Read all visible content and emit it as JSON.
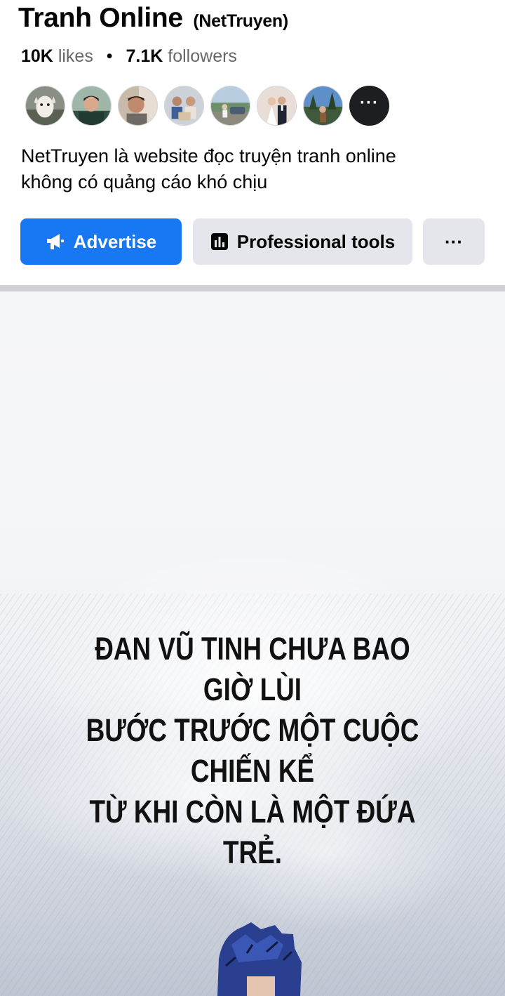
{
  "page": {
    "title": "Tranh Online",
    "handle": "(NetTruyen)",
    "likes_count": "10K",
    "likes_label": "likes",
    "dot": "•",
    "followers_count": "7.1K",
    "followers_label": "followers",
    "more_avatars": "···",
    "bio_line1": "NetTruyen là website đọc truyện tranh online",
    "bio_line2": "không có quảng cáo khó chịu"
  },
  "actions": {
    "advertise_label": "Advertise",
    "professional_tools_label": "Professional tools",
    "more_label": "···"
  },
  "comic": {
    "caption_line1": "ĐAN VŨ TINH CHƯA BAO GIỜ LÙI",
    "caption_line2": "BƯỚC TRƯỚC MỘT CUỘC CHIẾN KỂ",
    "caption_line3": "TỪ KHI CÒN LÀ MỘT ĐỨA TRẺ."
  },
  "colors": {
    "primary_button": "#1877f2",
    "secondary_button": "#e4e6eb",
    "divider": "#ced0d4",
    "hair": "#2a3f8f"
  },
  "icons": {
    "advertise": "megaphone-icon",
    "professional_tools": "bar-chart-icon",
    "more": "ellipsis-icon"
  }
}
